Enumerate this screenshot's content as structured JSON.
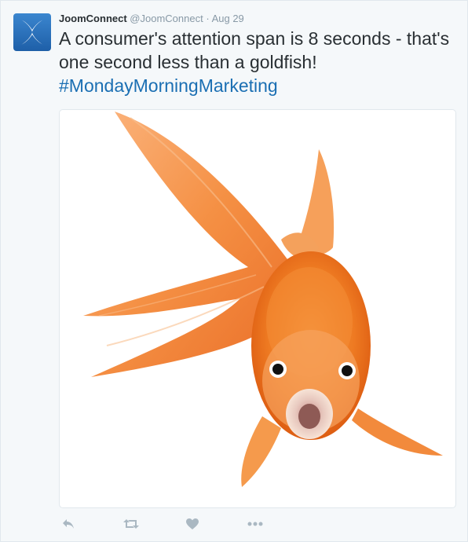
{
  "tweet": {
    "author_name": "JoomConnect",
    "author_handle": "@JoomConnect",
    "separator": "·",
    "time": "Aug 29",
    "text": "A consumer's attention span is 8 seconds - that's one second less than a goldfish!",
    "hashtag": "#MondayMorningMarketing"
  },
  "media": {
    "icon": "goldfish-photo"
  },
  "actions": [
    {
      "icon": "reply-icon"
    },
    {
      "icon": "retweet-icon"
    },
    {
      "icon": "like-icon"
    },
    {
      "icon": "more-icon"
    }
  ],
  "colors": {
    "avatar_bg": "#2d6fb7",
    "link": "#1b6fb3",
    "icon_gray": "#aab8c2"
  }
}
